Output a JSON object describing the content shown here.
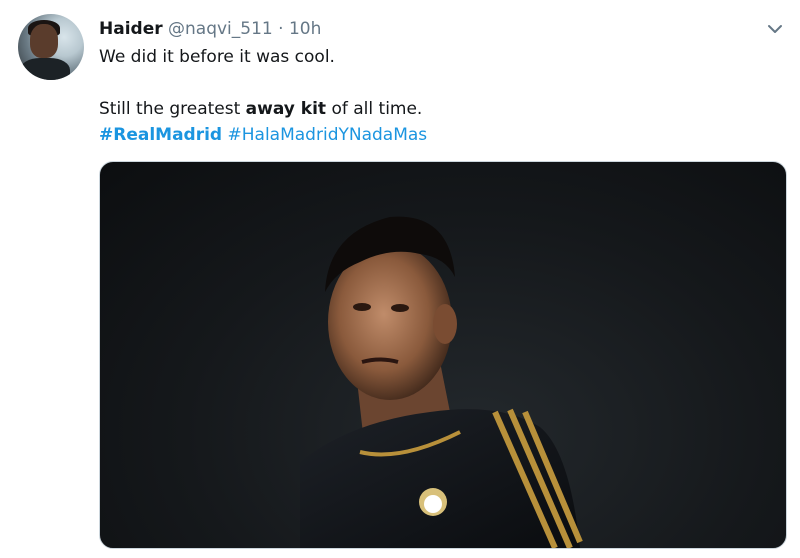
{
  "tweet": {
    "author_name": "Haider",
    "author_handle": "@naqvi_511",
    "separator": "·",
    "timestamp": "10h",
    "line1": "We did it before it was cool.",
    "line2_pre": "Still the greatest ",
    "line2_bold": "away kit",
    "line2_post": " of all time.",
    "hashtags": [
      "#RealMadrid",
      "#HalaMadridYNadaMas"
    ]
  },
  "icons": {
    "more": "chevron-down-icon"
  },
  "colors": {
    "text": "#14171a",
    "muted": "#657786",
    "link": "#1b95e0",
    "border": "#ccd6dd"
  }
}
